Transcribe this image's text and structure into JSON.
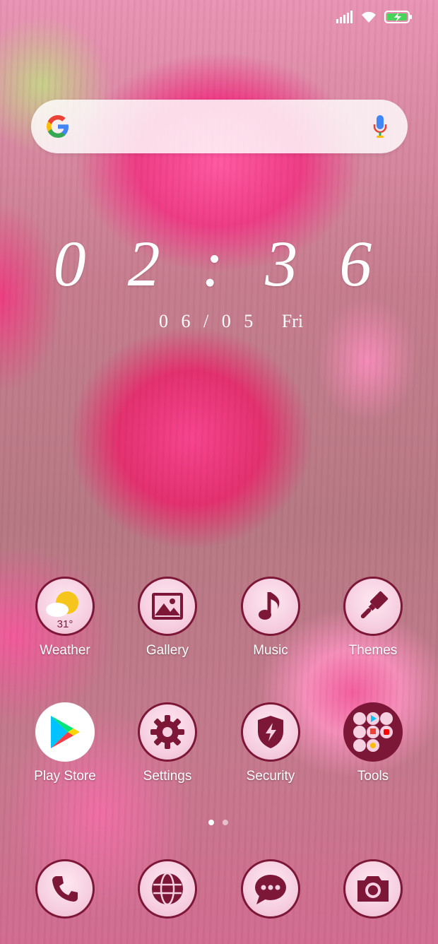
{
  "status_bar": {
    "icons": [
      "signal-icon",
      "wifi-icon",
      "battery-charging-icon"
    ]
  },
  "search_bar": {
    "icon_left": "google-g-icon",
    "icon_right": "microphone-icon"
  },
  "clock": {
    "time": "02:36",
    "date": "06/05",
    "weekday": "Fri"
  },
  "apps": [
    {
      "label": "Weather",
      "icon": "weather-icon",
      "badge": "31°"
    },
    {
      "label": "Gallery",
      "icon": "gallery-icon"
    },
    {
      "label": "Music",
      "icon": "music-note-icon"
    },
    {
      "label": "Themes",
      "icon": "paint-brush-icon"
    },
    {
      "label": "Play Store",
      "icon": "play-store-icon"
    },
    {
      "label": "Settings",
      "icon": "gear-icon"
    },
    {
      "label": "Security",
      "icon": "shield-icon"
    },
    {
      "label": "Tools",
      "icon": "folder-icon"
    }
  ],
  "dock": [
    {
      "icon": "phone-icon"
    },
    {
      "icon": "browser-globe-icon"
    },
    {
      "icon": "messages-icon"
    },
    {
      "icon": "camera-icon"
    }
  ],
  "page_indicator": {
    "pages": 2,
    "current": 1
  },
  "colors": {
    "icon_accent": "#7d1738",
    "icon_fill": "#f6cfe0"
  }
}
